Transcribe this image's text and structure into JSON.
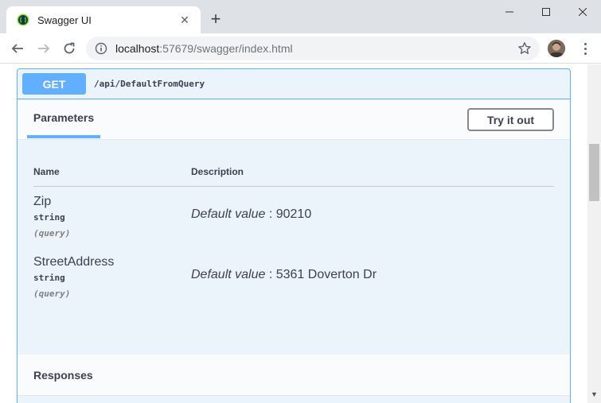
{
  "browser": {
    "tab_title": "Swagger UI",
    "tab_close": "✕",
    "new_tab": "+",
    "url_host": "localhost",
    "url_rest": ":57679/swagger/index.html"
  },
  "operation": {
    "method": "GET",
    "path": "/api/DefaultFromQuery"
  },
  "parameters": {
    "tab_label": "Parameters",
    "try_button": "Try it out",
    "col_name": "Name",
    "col_description": "Description",
    "items": [
      {
        "name": "Zip",
        "type": "string",
        "in": "(query)",
        "default_label": "Default value",
        "separator": " : ",
        "default_value": "90210"
      },
      {
        "name": "StreetAddress",
        "type": "string",
        "in": "(query)",
        "default_label": "Default value",
        "separator": " : ",
        "default_value": "5361 Doverton Dr"
      }
    ]
  },
  "responses": {
    "label": "Responses"
  },
  "colors": {
    "get_accent": "#61affe",
    "block_bg": "#ebf3fb",
    "text": "#3b4151"
  }
}
